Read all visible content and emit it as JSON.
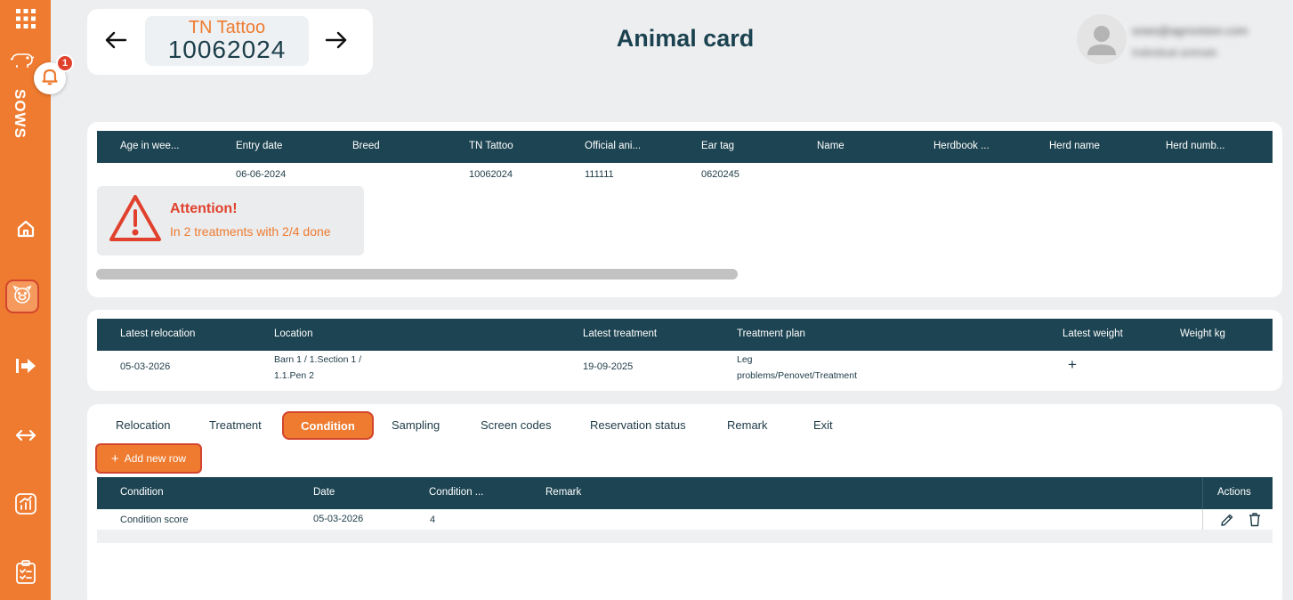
{
  "header": {
    "tattoo_label": "TN Tattoo",
    "tattoo_value": "10062024",
    "page_title": "Animal card",
    "user_email": "sows@agrovision.com",
    "user_role": "Individual animals"
  },
  "sidebar": {
    "section_label": "SOWS",
    "notification_count": "1",
    "items": [
      {
        "icon": "apps-grid-icon"
      },
      {
        "icon": "pig-icon"
      },
      {
        "icon": "home-icon"
      },
      {
        "icon": "pig-face-icon"
      },
      {
        "icon": "exit-arrow-icon"
      },
      {
        "icon": "transfer-icon"
      },
      {
        "icon": "report-chart-icon"
      },
      {
        "icon": "checklist-icon"
      }
    ]
  },
  "animal_table": {
    "columns": [
      "Age in wee...",
      "Entry date",
      "Breed",
      "TN Tattoo",
      "Official ani...",
      "Ear tag",
      "Name",
      "Herdbook ...",
      "Herd name",
      "Herd numb..."
    ],
    "row": [
      "",
      "06-06-2024",
      "",
      "10062024",
      "111111",
      "0620245",
      "",
      "",
      "",
      ""
    ]
  },
  "attention": {
    "title": "Attention!",
    "text": "In 2 treatments with 2/4 done"
  },
  "status_table": {
    "columns": [
      "Latest relocation",
      "Location",
      "Latest treatment",
      "Treatment plan",
      "Latest weight",
      "Weight kg"
    ],
    "row": {
      "latest_relocation": "05-03-2026",
      "location_line1": "Barn 1 / 1.Section 1 /",
      "location_line2": "1.1.Pen 2",
      "latest_treatment": "19-09-2025",
      "plan_line1": "Leg",
      "plan_line2": "problems/Penovet/Treatment",
      "latest_weight_add": "+"
    }
  },
  "tabs": {
    "items": [
      "Relocation",
      "Treatment",
      "Condition",
      "Sampling",
      "Screen codes",
      "Reservation status",
      "Remark",
      "Exit"
    ],
    "active": "Condition",
    "add_row_label": "Add new row",
    "add_row_plus": "+"
  },
  "condition_table": {
    "columns": [
      "Condition",
      "Date",
      "Condition ...",
      "Remark"
    ],
    "actions_header": "Actions",
    "rows": [
      {
        "condition": "Condition score",
        "date": "05-03-2026",
        "value": "4",
        "remark": ""
      }
    ]
  },
  "colors": {
    "accent": "#ee7b30",
    "header_dark": "#1d4452",
    "alert_red": "#e0412d"
  }
}
